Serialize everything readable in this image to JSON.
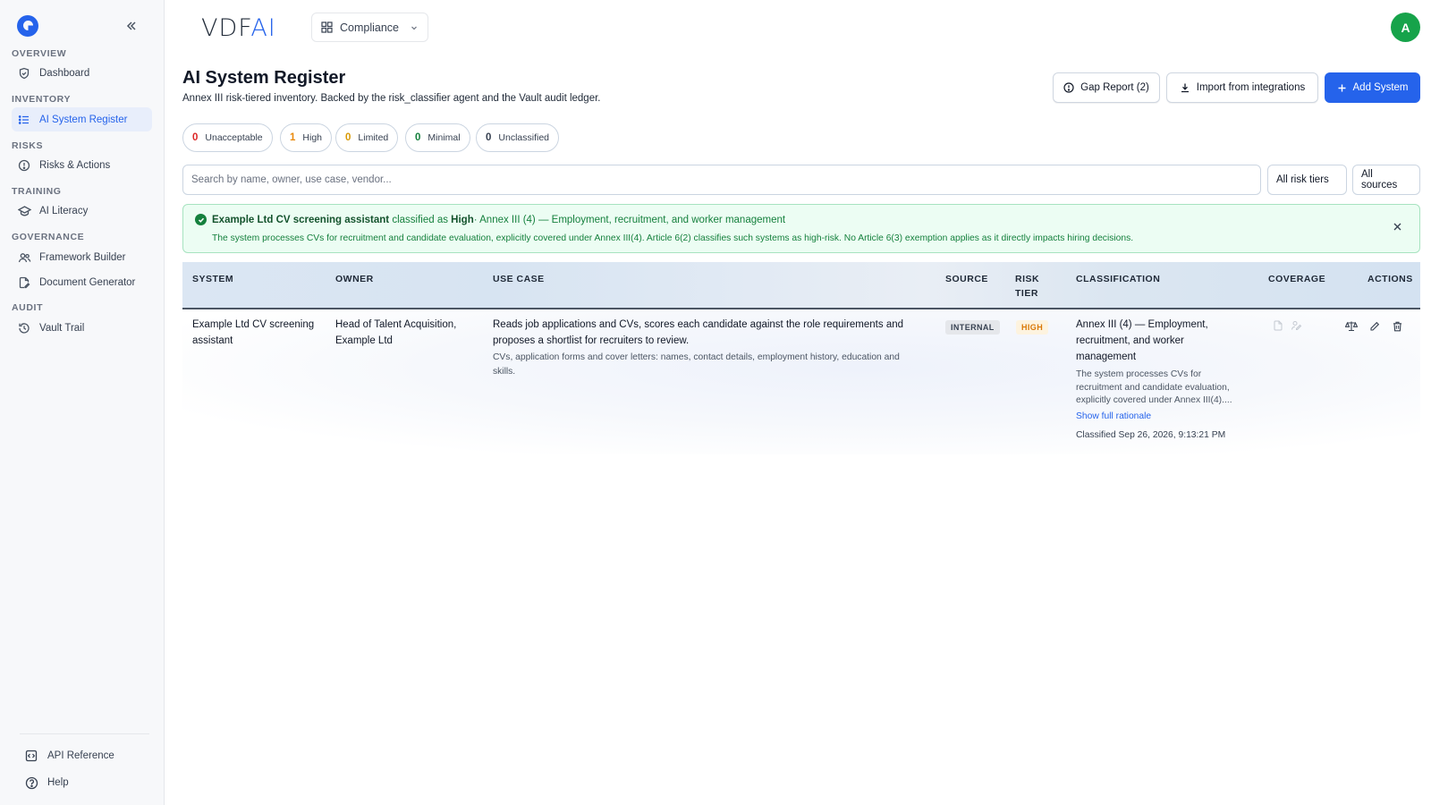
{
  "sidebar": {
    "sections": {
      "overview": "OVERVIEW",
      "inventory": "INVENTORY",
      "risks": "RISKS",
      "training": "TRAINING",
      "governance": "GOVERNANCE",
      "audit": "AUDIT"
    },
    "items": {
      "dashboard": "Dashboard",
      "register": "AI System Register",
      "risks_actions": "Risks & Actions",
      "literacy": "AI Literacy",
      "framework": "Framework Builder",
      "docgen": "Document Generator",
      "vault": "Vault Trail"
    },
    "footer": {
      "api": "API Reference",
      "help": "Help"
    }
  },
  "topbar": {
    "brand_main": "VDF",
    "brand_accent": "AI",
    "module": "Compliance",
    "avatar_initial": "A"
  },
  "header": {
    "title": "AI System Register",
    "subtitle": "Annex III risk-tiered inventory. Backed by the risk_classifier agent and the Vault audit ledger.",
    "gap_report": "Gap Report (2)",
    "import": "Import from integrations",
    "add": "Add System"
  },
  "tiers": [
    {
      "count": "0",
      "label": "Unacceptable",
      "color": "#dc2626"
    },
    {
      "count": "1",
      "label": "High",
      "color": "#ea8a0c"
    },
    {
      "count": "0",
      "label": "Limited",
      "color": "#d99a06"
    },
    {
      "count": "0",
      "label": "Minimal",
      "color": "#15803d"
    },
    {
      "count": "0",
      "label": "Unclassified",
      "color": "#374151"
    }
  ],
  "filters": {
    "search_placeholder": "Search by name, owner, use case, vendor...",
    "risk_tiers": "All risk tiers",
    "sources": "All sources"
  },
  "notice": {
    "system": "Example Ltd CV screening assistant",
    "classified_as": "classified as",
    "tier": "High",
    "category": "· Annex III (4) — Employment, recruitment, and worker management",
    "rationale": "The system processes CVs for recruitment and candidate evaluation, explicitly covered under Annex III(4). Article 6(2) classifies such systems as high-risk. No Article 6(3) exemption applies as it directly impacts hiring decisions."
  },
  "table": {
    "columns": {
      "system": "SYSTEM",
      "owner": "OWNER",
      "use_case": "USE CASE",
      "source": "SOURCE",
      "risk_tier_1": "RISK",
      "risk_tier_2": "TIER",
      "classification": "CLASSIFICATION",
      "coverage": "COVERAGE",
      "actions": "ACTIONS"
    },
    "rows": [
      {
        "system_l1": "Example Ltd CV screening",
        "system_l2": "assistant",
        "owner_l1": "Head of Talent Acquisition,",
        "owner_l2": "Example Ltd",
        "use_case_l1": "Reads job applications and CVs, scores each candidate against the role requirements and",
        "use_case_l2": "proposes a shortlist for recruiters to review.",
        "data_l1": "CVs, application forms and cover letters: names, contact details, employment history, education and",
        "data_l2": "skills.",
        "source": "INTERNAL",
        "tier": "HIGH",
        "class_l1": "Annex III (4) — Employment,",
        "class_l2": "recruitment, and worker",
        "class_l3": "management",
        "rat_l1": "The system processes CVs for",
        "rat_l2": "recruitment and candidate evaluation,",
        "rat_l3": "explicitly covered under Annex III(4)....",
        "show_rationale": "Show full rationale",
        "classified_at": "Classified Sep 26, 2026, 9:13:21 PM"
      }
    ]
  },
  "colors": {
    "accent": "#2563eb",
    "success": "#15803d",
    "avatar": "#16a34a",
    "high": "#d97706"
  }
}
